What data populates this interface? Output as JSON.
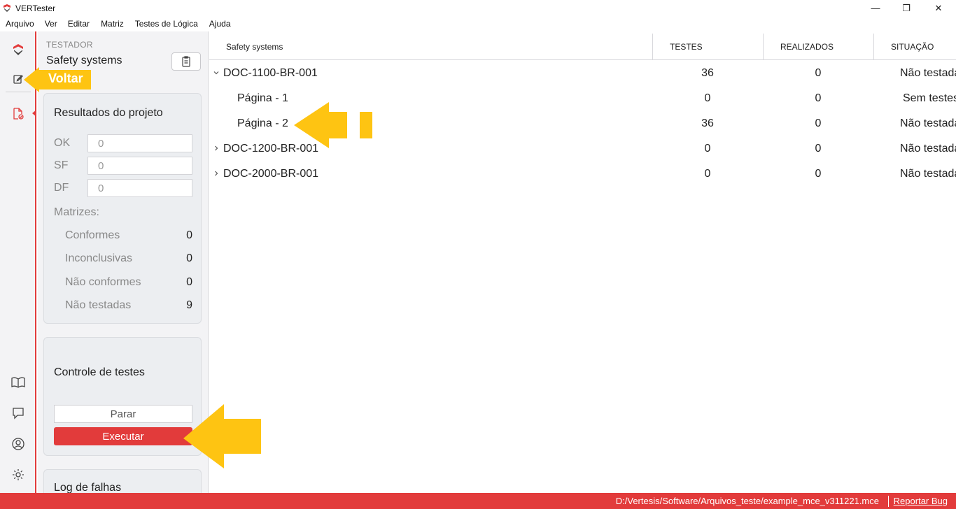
{
  "window": {
    "title": "VERTester",
    "controls": [
      "—",
      "❐",
      "✕"
    ]
  },
  "menu": [
    "Arquivo",
    "Ver",
    "Editar",
    "Matriz",
    "Testes de Lógica",
    "Ajuda"
  ],
  "rail": {
    "icons": [
      "logo-icon",
      "edit-icon",
      "document-check-icon",
      "book-icon",
      "chat-icon",
      "user-icon",
      "settings-icon"
    ]
  },
  "panel": {
    "tester_label": "TESTADOR",
    "project_name": "Safety systems",
    "results": {
      "title": "Resultados do projeto",
      "fields": [
        {
          "label": "OK",
          "value": "0"
        },
        {
          "label": "SF",
          "value": "0"
        },
        {
          "label": "DF",
          "value": "0"
        }
      ],
      "matrices_title": "Matrizes:",
      "matrices": [
        {
          "label": "Conformes",
          "value": "0"
        },
        {
          "label": "Inconclusivas",
          "value": "0"
        },
        {
          "label": "Não conformes",
          "value": "0"
        },
        {
          "label": "Não testadas",
          "value": "9"
        }
      ]
    },
    "control": {
      "title": "Controle de testes",
      "stop_label": "Parar",
      "run_label": "Executar"
    },
    "log": {
      "title": "Log de falhas"
    }
  },
  "table": {
    "columns": [
      "Safety systems",
      "TESTES",
      "REALIZADOS",
      "SITUAÇÃO"
    ],
    "rows": [
      {
        "name": "DOC-1100-BR-001",
        "tests": "36",
        "done": "0",
        "status": "Não testada",
        "expanded": true,
        "level": 0
      },
      {
        "name": "Página - 1",
        "tests": "0",
        "done": "0",
        "status": "Sem testes",
        "level": 1
      },
      {
        "name": "Página - 2",
        "tests": "36",
        "done": "0",
        "status": "Não testada",
        "level": 1
      },
      {
        "name": "DOC-1200-BR-001",
        "tests": "0",
        "done": "0",
        "status": "Não testada",
        "expanded": false,
        "level": 0
      },
      {
        "name": "DOC-2000-BR-001",
        "tests": "0",
        "done": "0",
        "status": "Não testada",
        "expanded": false,
        "level": 0
      }
    ]
  },
  "annotation": {
    "voltar_label": "Voltar",
    "color": "#fec412"
  },
  "statusbar": {
    "path": "D:/Vertesis/Software/Arquivos_teste/example_mce_v311221.mce",
    "bug_link": "Reportar Bug"
  },
  "colors": {
    "accent": "#e23b3b",
    "panel_bg": "#f3f3f5"
  }
}
